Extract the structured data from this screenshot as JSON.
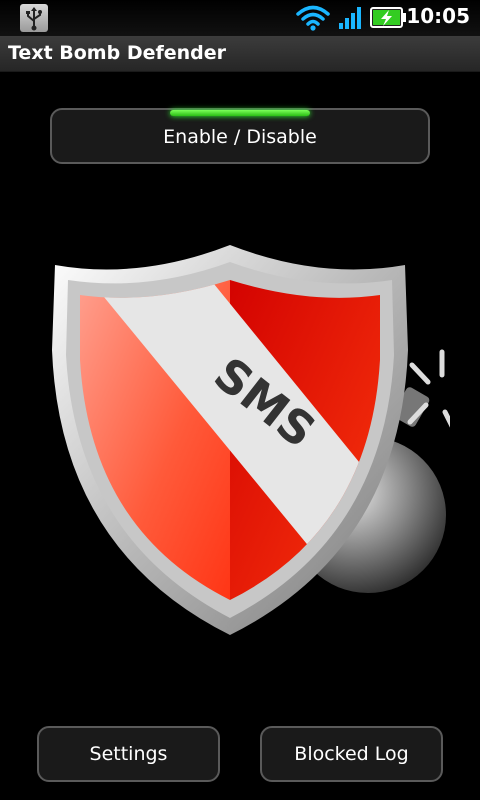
{
  "status_bar": {
    "time": "10:05",
    "icons": [
      "usb-icon",
      "wifi-icon",
      "signal-icon",
      "battery-charging-icon"
    ]
  },
  "app": {
    "title": "Text Bomb Defender"
  },
  "toggle": {
    "label": "Enable / Disable",
    "indicator_color": "#2bbd14"
  },
  "shield": {
    "text": "SMS"
  },
  "buttons": {
    "settings": "Settings",
    "blocked_log": "Blocked Log"
  },
  "colors": {
    "background": "#000000",
    "button_border": "#5a5a5a",
    "shield_red": "#ff3b14"
  }
}
